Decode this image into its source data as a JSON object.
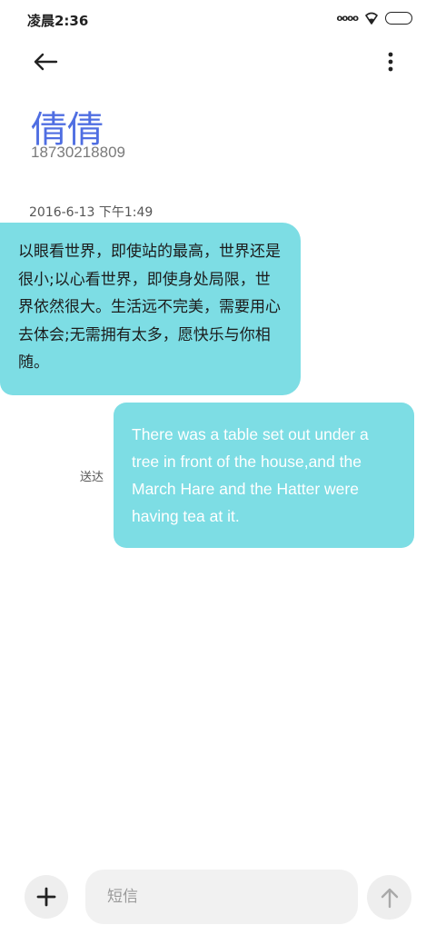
{
  "status_bar": {
    "time": "凌晨2:36",
    "signal": "oooo",
    "icons": [
      "signal-icon",
      "wifi-icon",
      "battery-icon"
    ]
  },
  "header": {
    "back_icon": "arrow-left-icon",
    "more_icon": "more-vertical-icon"
  },
  "contact": {
    "name": "倩倩",
    "number": "18730218809"
  },
  "conversation": {
    "timestamp": "2016-6-13 下午1:49",
    "messages": [
      {
        "direction": "incoming",
        "text": "以眼看世界，即使站的最高，世界还是很小;以心看世界，即使身处局限，世界依然很大。生活远不完美，需要用心去体会;无需拥有太多，愿快乐与你相随。"
      },
      {
        "direction": "outgoing",
        "text": "There was a table set out under a tree in front of the house,and the March Hare and the Hatter were having tea at it.",
        "status": "送达"
      }
    ]
  },
  "composer": {
    "placeholder": "短信",
    "value": "",
    "add_icon": "plus-icon",
    "send_icon": "arrow-up-icon"
  },
  "colors": {
    "bubble": "#7ddde4",
    "contact_name": "#4f6ee2",
    "background": "#ffffff"
  }
}
